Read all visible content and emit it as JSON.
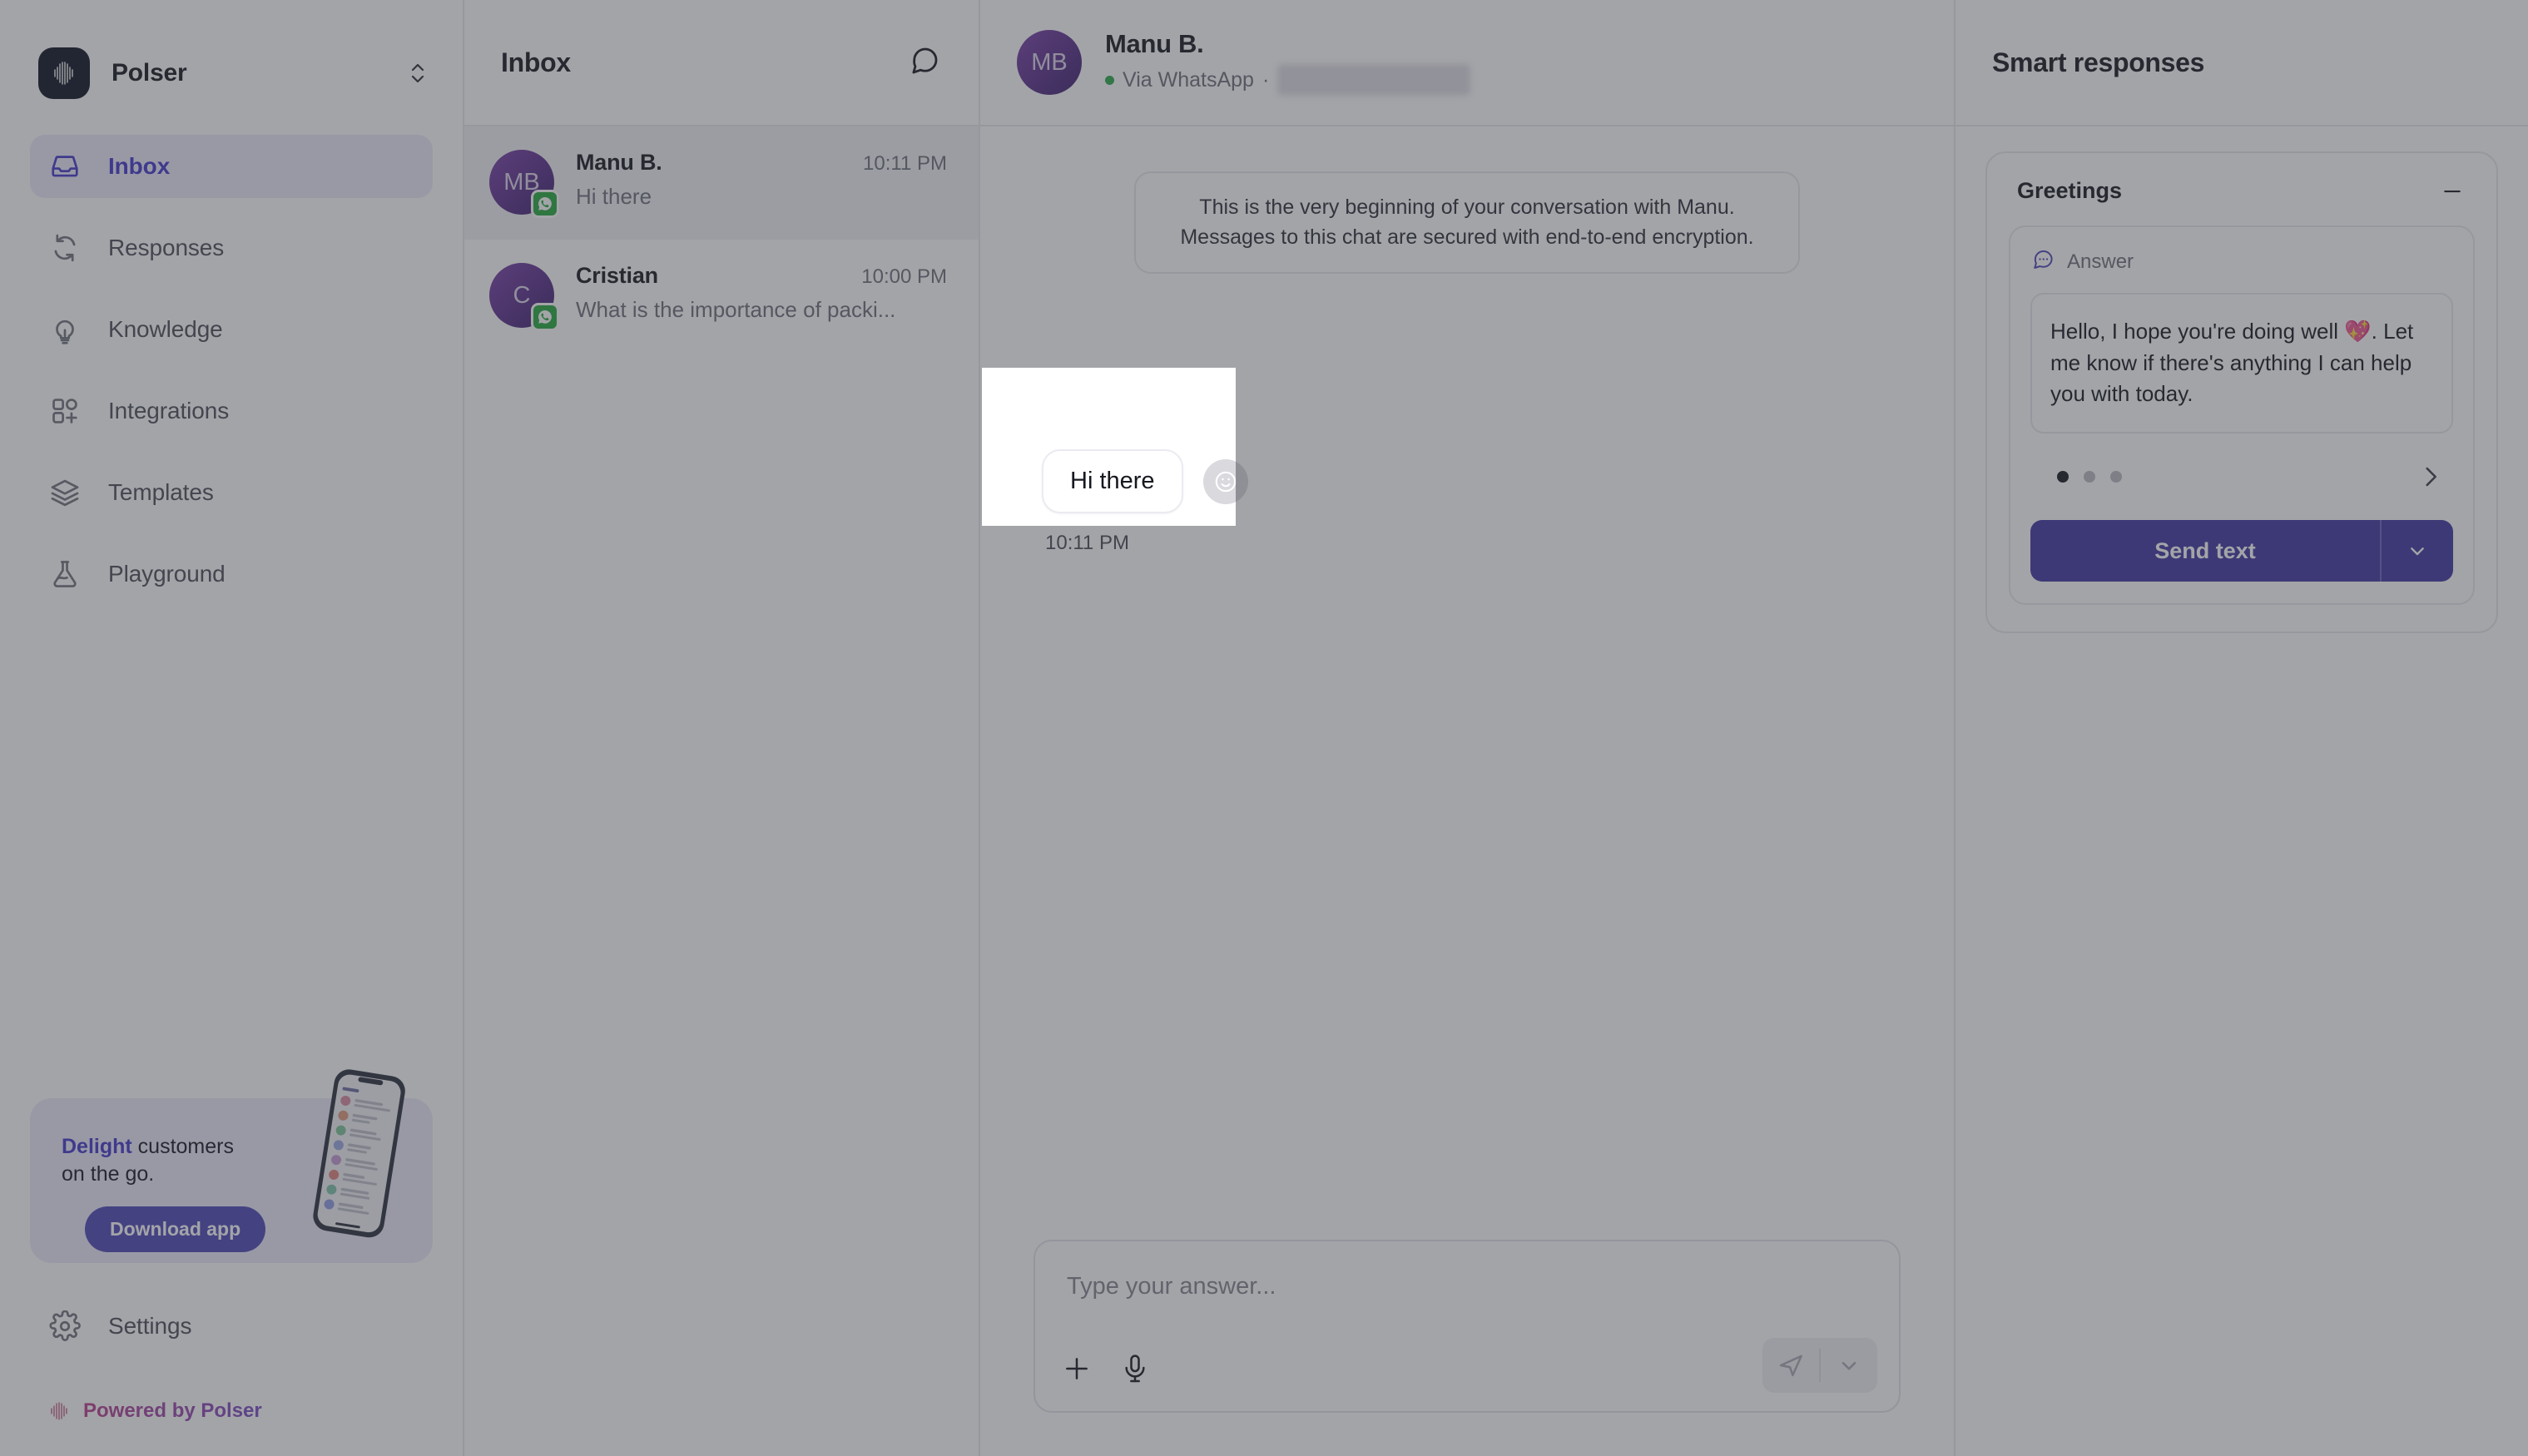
{
  "sidebar": {
    "brand": {
      "name": "Polser",
      "logo_icon": "pulse-logo-icon",
      "switcher_icon": "chevron-up-down-icon"
    },
    "items": [
      {
        "label": "Inbox",
        "icon": "inbox-icon",
        "active": true
      },
      {
        "label": "Responses",
        "icon": "refresh-cycle-icon",
        "active": false
      },
      {
        "label": "Knowledge",
        "icon": "lightbulb-icon",
        "active": false
      },
      {
        "label": "Integrations",
        "icon": "grid-plus-icon",
        "active": false
      },
      {
        "label": "Templates",
        "icon": "layers-icon",
        "active": false
      },
      {
        "label": "Playground",
        "icon": "flask-icon",
        "active": false
      }
    ],
    "promo": {
      "highlight": "Delight",
      "rest": " customers",
      "line2": "on the go.",
      "button": "Download app",
      "phone_icon": "phone-mockup-image"
    },
    "settings": {
      "label": "Settings",
      "icon": "gear-icon"
    },
    "powered": {
      "label": "Powered by Polser",
      "icon": "pulse-mark-icon"
    }
  },
  "inbox": {
    "title": "Inbox",
    "compose_icon": "new-chat-icon",
    "conversations": [
      {
        "initials": "MB",
        "name": "Manu B.",
        "time": "10:11 PM",
        "snippet": "Hi there",
        "channel_icon": "whatsapp-icon",
        "selected": true
      },
      {
        "initials": "C",
        "name": "Cristian",
        "time": "10:00 PM",
        "snippet": "What is the importance of packi...",
        "channel_icon": "whatsapp-icon",
        "selected": false
      }
    ]
  },
  "chat": {
    "header": {
      "initials": "MB",
      "name": "Manu B.",
      "channel": "Via WhatsApp",
      "separator": "·",
      "status_icon": "online-dot-icon"
    },
    "system_note_line1": "This is the very beginning of your conversation with Manu.",
    "system_note_line2": "Messages to this chat are secured with end-to-end encryption.",
    "message": {
      "text": "Hi there",
      "time": "10:11 PM",
      "react_icon": "emoji-smile-icon"
    },
    "composer": {
      "placeholder": "Type your answer...",
      "attach_icon": "plus-icon",
      "mic_icon": "microphone-icon",
      "send_icon": "send-paper-plane-icon",
      "send_options_icon": "chevron-down-icon"
    }
  },
  "smart_responses": {
    "title": "Smart responses",
    "card": {
      "title": "Greetings",
      "collapse_icon": "minus-icon",
      "answer_label": "Answer",
      "answer_icon": "chat-dots-icon",
      "answer_text": "Hello, I hope you're doing well 💖. Let me know if there's anything I can help you with today.",
      "carousel": {
        "total": 3,
        "active_index": 0,
        "next_icon": "chevron-right-icon"
      },
      "send_button": {
        "label": "Send text",
        "caret_icon": "chevron-down-icon"
      }
    }
  },
  "colors": {
    "accent": "#4338ca",
    "button": "#3f35a0",
    "active_nav_bg": "#eceafc",
    "whatsapp_green": "#25a93e",
    "online_green": "#2ca84b"
  }
}
